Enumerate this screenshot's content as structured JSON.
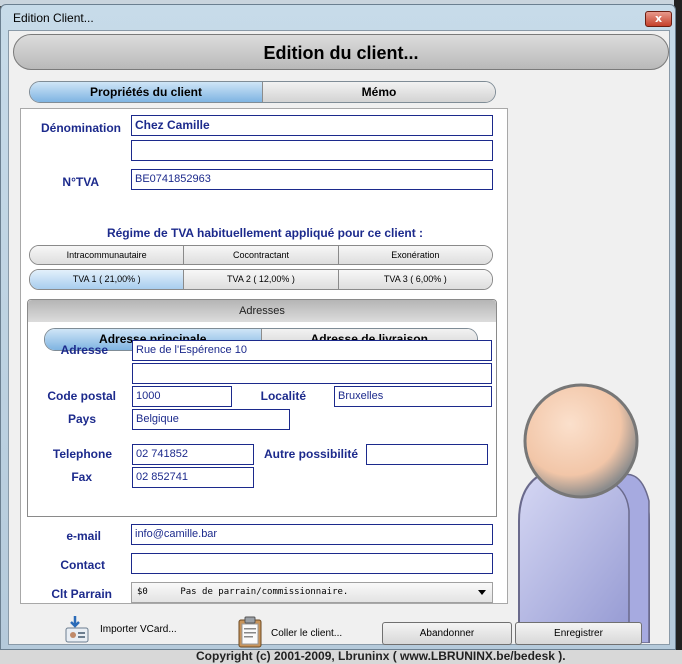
{
  "window": {
    "title": "Edition Client...",
    "close_glyph": "x"
  },
  "background": {
    "footer_text": "Copyright (c) 2001-2009, Lbruninx ( www.LBRUNINX.be/bedesk )."
  },
  "header": {
    "title": "Edition du client..."
  },
  "tabs": [
    {
      "label": "Propriétés du client",
      "active": true
    },
    {
      "label": "Mémo",
      "active": false
    }
  ],
  "form": {
    "denomination": {
      "label": "Dénomination",
      "value": "Chez Camille",
      "value2": ""
    },
    "tva": {
      "label": "N°TVA",
      "value": "BE0741852963"
    },
    "regime_title": "Régime de TVA habituellement appliqué pour ce client :",
    "regime_options": [
      "Intracommunautaire",
      "Cocontractant",
      "Exonération"
    ],
    "tva_rates": [
      {
        "label": "TVA 1 ( 21,00% )",
        "selected": true
      },
      {
        "label": "TVA 2 ( 12,00% )",
        "selected": false
      },
      {
        "label": "TVA 3 ( 6,00% )",
        "selected": false
      }
    ],
    "addresses": {
      "group_title": "Adresses",
      "tabs": [
        {
          "label": "Adresse principale",
          "active": true
        },
        {
          "label": "Adresse de livraison",
          "active": false
        }
      ],
      "adresse": {
        "label": "Adresse",
        "value": "Rue de l'Espérence 10",
        "value2": ""
      },
      "code_postal": {
        "label": "Code postal",
        "value": "1000"
      },
      "localite": {
        "label": "Localité",
        "value": "Bruxelles"
      },
      "pays": {
        "label": "Pays",
        "value": "Belgique"
      },
      "telephone": {
        "label": "Telephone",
        "value": "02 741852"
      },
      "autre": {
        "label": "Autre possibilité",
        "value": ""
      },
      "fax": {
        "label": "Fax",
        "value": "02 852741"
      }
    },
    "email": {
      "label": "e-mail",
      "value": "info@camille.bar"
    },
    "contact": {
      "label": "Contact",
      "value": ""
    },
    "parrain": {
      "label": "Clt Parrain",
      "value": "$0      Pas de parrain/commissionnaire."
    }
  },
  "buttons": {
    "import_vcard": "Importer VCard...",
    "paste_client": "Coller le client...",
    "cancel": "Abandonner",
    "save": "Enregistrer"
  },
  "colors": {
    "label_blue": "#1c2a8c",
    "active_tab": "#7fb4e2",
    "avatar_head": "#f2c6a8",
    "avatar_body": "#b9bde8"
  }
}
